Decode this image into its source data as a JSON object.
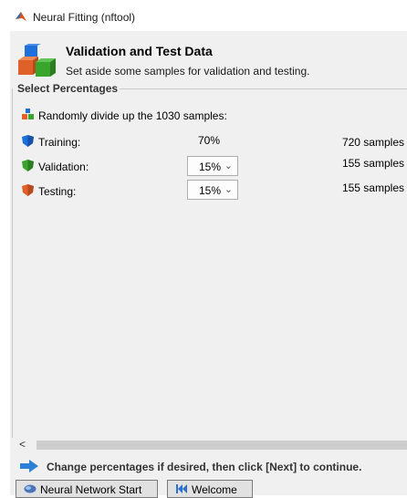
{
  "window": {
    "title": "Neural Fitting (nftool)"
  },
  "header": {
    "title": "Validation and Test Data",
    "subtitle": "Set aside some samples for validation and testing."
  },
  "group": {
    "legend": "Select Percentages",
    "intro": "Randomly divide up the 1030 samples:",
    "rows": [
      {
        "label": "Training:",
        "percent": "70%",
        "samples": "720 samples"
      },
      {
        "label": "Validation:",
        "percent": "15%",
        "samples": "155 samples"
      },
      {
        "label": "Testing:",
        "percent": "15%",
        "samples": "155 samples"
      }
    ]
  },
  "scrollbar": {
    "left_arrow": "<"
  },
  "hint": "Change percentages if desired, then click [Next] to continue.",
  "buttons": {
    "nn_start": "Neural Network Start",
    "welcome": "Welcome"
  },
  "colors": {
    "training": "#1e6fd9",
    "validation": "#3aa52c",
    "testing": "#e0602a",
    "matlab_orange": "#d9541a"
  }
}
